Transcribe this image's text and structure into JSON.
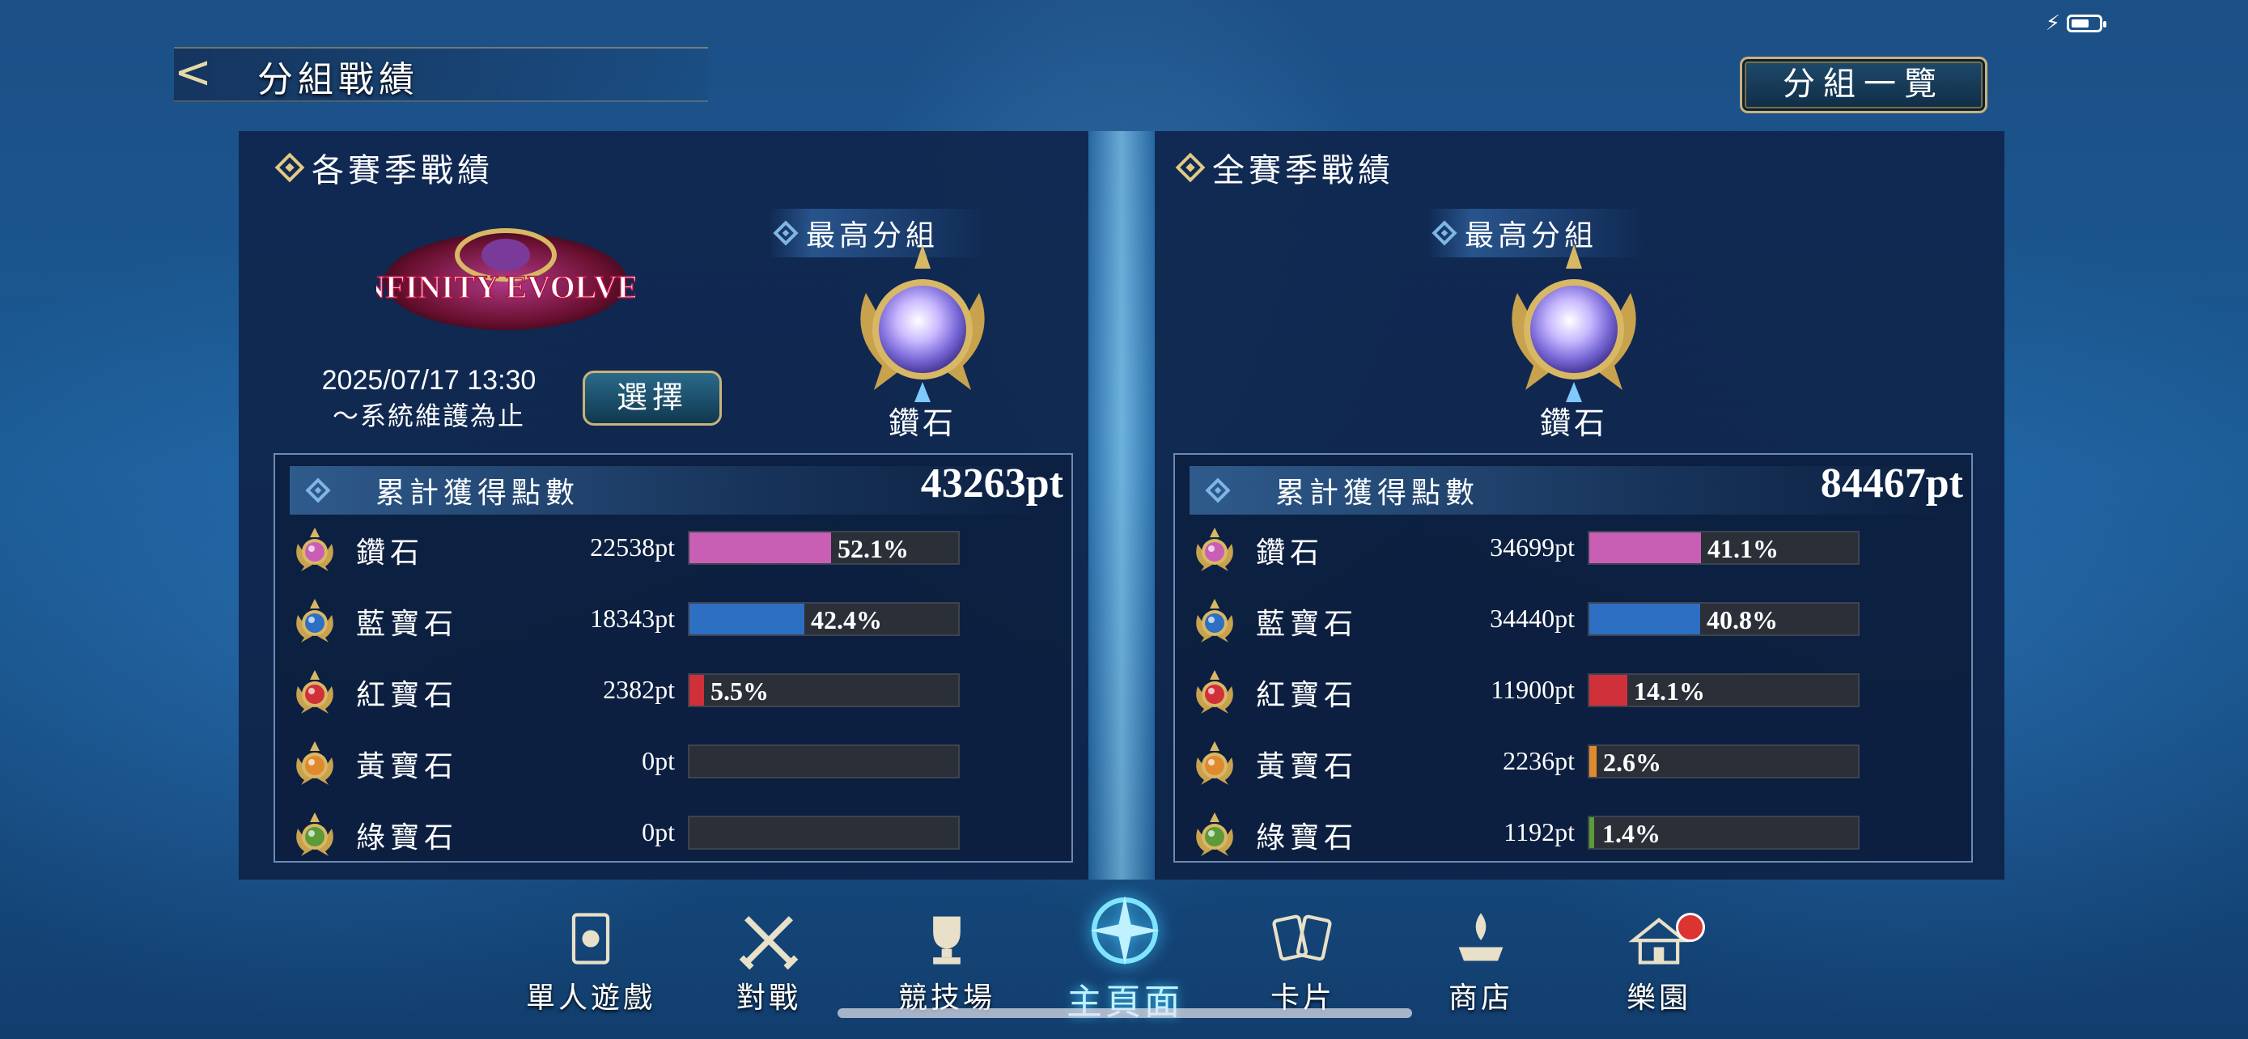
{
  "header": {
    "title": "分組戰績",
    "list_button": "分組一覽"
  },
  "left_panel": {
    "section_title": "各賽季戰績",
    "logo_text": "INFINITY EVOLVED",
    "date_line1": "2025/07/17 13:30",
    "date_line2": "～系統維護為止",
    "select_button": "選擇",
    "highest_label": "最高分組",
    "highest_rank": "鑽石",
    "points_title": "累計獲得點數",
    "points_total": "43263pt",
    "rows": [
      {
        "name": "鑽石",
        "points": "22538pt",
        "percent_text": "52.1%",
        "percent": 52.1,
        "color": "#c85fb5"
      },
      {
        "name": "藍寶石",
        "points": "18343pt",
        "percent_text": "42.4%",
        "percent": 42.4,
        "color": "#2d6fc3"
      },
      {
        "name": "紅寶石",
        "points": "2382pt",
        "percent_text": "5.5%",
        "percent": 5.5,
        "color": "#d0303a"
      },
      {
        "name": "黃寶石",
        "points": "0pt",
        "percent_text": "",
        "percent": 0,
        "color": "#e08a30"
      },
      {
        "name": "綠寶石",
        "points": "0pt",
        "percent_text": "",
        "percent": 0,
        "color": "#5c9a3a"
      }
    ]
  },
  "right_panel": {
    "section_title": "全賽季戰績",
    "highest_label": "最高分組",
    "highest_rank": "鑽石",
    "points_title": "累計獲得點數",
    "points_total": "84467pt",
    "rows": [
      {
        "name": "鑽石",
        "points": "34699pt",
        "percent_text": "41.1%",
        "percent": 41.1,
        "color": "#c85fb5"
      },
      {
        "name": "藍寶石",
        "points": "34440pt",
        "percent_text": "40.8%",
        "percent": 40.8,
        "color": "#2d6fc3"
      },
      {
        "name": "紅寶石",
        "points": "11900pt",
        "percent_text": "14.1%",
        "percent": 14.1,
        "color": "#d0303a"
      },
      {
        "name": "黃寶石",
        "points": "2236pt",
        "percent_text": "2.6%",
        "percent": 2.6,
        "color": "#e08a30"
      },
      {
        "name": "綠寶石",
        "points": "1192pt",
        "percent_text": "1.4%",
        "percent": 1.4,
        "color": "#5c9a3a"
      }
    ]
  },
  "nav": {
    "items": [
      {
        "label": "單人遊戲",
        "icon": "solo-play-icon"
      },
      {
        "label": "對戰",
        "icon": "battle-swords-icon"
      },
      {
        "label": "競技場",
        "icon": "arena-trophy-icon"
      },
      {
        "label": "主頁面",
        "icon": "home-emblem-icon",
        "active": true
      },
      {
        "label": "卡片",
        "icon": "cards-icon"
      },
      {
        "label": "商店",
        "icon": "shop-icon"
      },
      {
        "label": "樂園",
        "icon": "park-icon",
        "badge": true
      }
    ]
  }
}
